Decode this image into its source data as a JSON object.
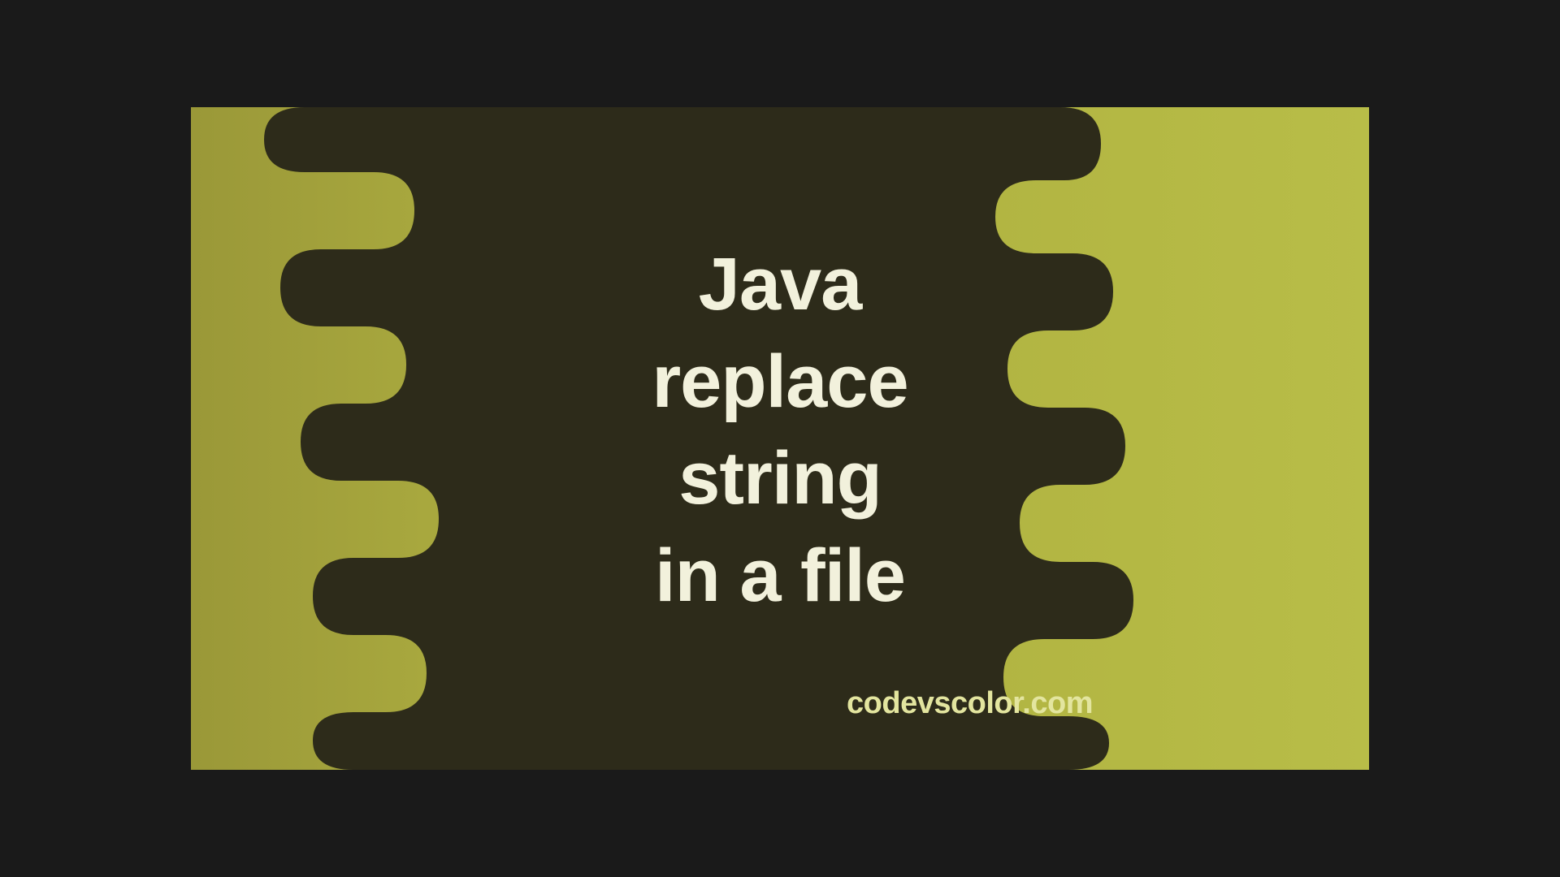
{
  "title": {
    "line1": "Java",
    "line2": "replace",
    "line3": "string",
    "line4": "in a file"
  },
  "siteUrl": "codevscolor.com",
  "colors": {
    "blob": "#2d2b1a",
    "titleText": "#f2f1dc",
    "urlText": "#e3e59f"
  }
}
